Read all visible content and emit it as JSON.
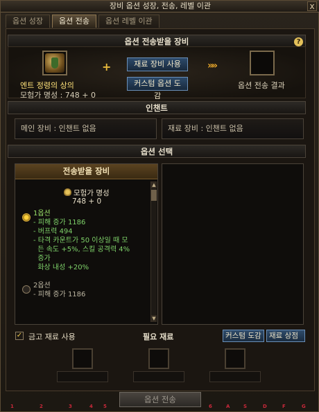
{
  "window": {
    "title": "장비 옵션 성장, 전송, 레벨 이관",
    "close_label": "x"
  },
  "tabs": [
    {
      "label": "옵션 성장"
    },
    {
      "label": "옵션 전송"
    },
    {
      "label": "옵션 레벨 이관"
    }
  ],
  "header": {
    "title": "옵션 전송받을 장비",
    "help_label": "?"
  },
  "source_item": {
    "name": "엔트 정령의 상의",
    "reputation": "모험가 명성 : 748 + 0",
    "icon": "armor-icon"
  },
  "buttons": {
    "material_use": "재료 장비 사용",
    "custom_codex": "커스텀 옵션 도감"
  },
  "symbols": {
    "plus": "+",
    "arrows": "»»"
  },
  "result": {
    "label": "옵션 전송 결과"
  },
  "enchant": {
    "title": "인챈트",
    "main": "메인 장비 : 인챈트 없음",
    "material": "재료 장비 : 인챈트 없음"
  },
  "option_select": {
    "title": "옵션 선택",
    "list_title": "전송받을 장비",
    "reputation_label": "모험가 명성",
    "reputation_value": "748 + 0",
    "options": [
      {
        "title": "1옵션",
        "selected": true,
        "lines": [
          "- 피해 증가 1186",
          "- 버프력 494",
          "- 타격 카운트가 50 이상일 때 모",
          "  든 속도 +5%, 스킬 공격력 4%",
          "  증가",
          "  화상 내성 +20%"
        ]
      },
      {
        "title": "2옵션",
        "selected": false,
        "lines": [
          "- 피해 증가 1186"
        ]
      }
    ]
  },
  "footer": {
    "gold_material_checkbox": "금고 재료 사용",
    "checked_mark": "✓",
    "required_materials": "필요 재료",
    "custom_codex_btn": "커스텀 도감",
    "material_shop_btn": "재료 상점",
    "transfer_btn": "옵션 전송"
  },
  "quickbar_keys": [
    "1",
    "2",
    "3",
    "4",
    "5",
    "6",
    "A",
    "S",
    "D",
    "F",
    "G"
  ],
  "colors": {
    "accent_gold": "#ffe27a",
    "option_green": "#7fd36a",
    "button_blue": "#2d4a6a"
  }
}
